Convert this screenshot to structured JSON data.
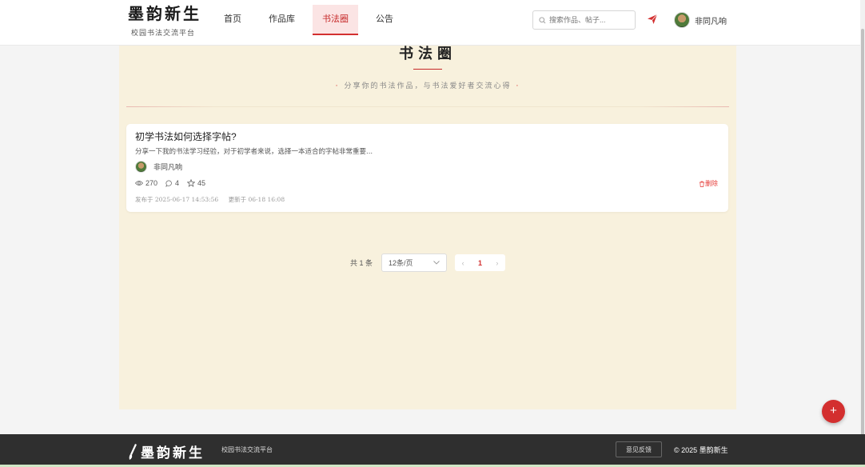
{
  "header": {
    "logo_title": "墨韵新生",
    "logo_subtitle": "校园书法交流平台",
    "nav": [
      {
        "label": "首页",
        "active": false
      },
      {
        "label": "作品库",
        "active": false
      },
      {
        "label": "书法圈",
        "active": true
      },
      {
        "label": "公告",
        "active": false
      }
    ],
    "search_placeholder": "搜索作品、帖子...",
    "user_name": "非同凡响"
  },
  "section": {
    "title": "书法圈",
    "subtitle": "分享你的书法作品，与书法爱好者交流心得"
  },
  "posts": [
    {
      "title": "初学书法如何选择字帖?",
      "excerpt": "分享一下我的书法学习经验，对于初学者来说，选择一本适合的字帖非常重要...",
      "author": "非同凡响",
      "views": "270",
      "comments": "4",
      "favorites": "45",
      "delete_label": "删除",
      "published": "发布于 2025-06-17 14:53:56",
      "updated": "更新于 06-18 16:08"
    }
  ],
  "pagination": {
    "total": "共 1 条",
    "page_size": "12条/页",
    "current_page": "1"
  },
  "fab_label": "+",
  "footer": {
    "logo_title": "墨韵新生",
    "subtitle": "校园书法交流平台",
    "feedback": "意见反馈",
    "copyright": "© 2025 墨韵新生"
  },
  "colors": {
    "accent": "#d32f2f",
    "panel_bg": "#f8f1dd",
    "footer_bg": "#2f2f2f"
  }
}
